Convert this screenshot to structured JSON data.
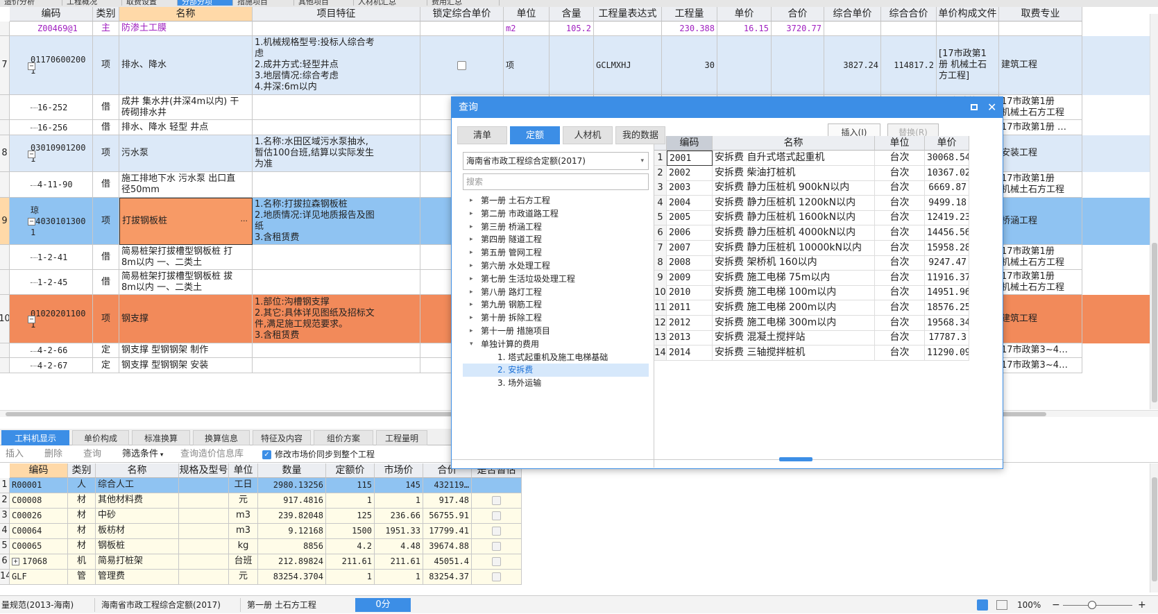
{
  "top_tabs": [
    "造价分析",
    "工程概况",
    "取费设置",
    "分部分项",
    "措施项目",
    "其他项目",
    "人材机汇总",
    "费用汇总"
  ],
  "grid": {
    "headers": [
      "编码",
      "类别",
      "名称",
      "项目特征",
      "锁定综合单价",
      "单位",
      "含量",
      "工程量表达式",
      "工程量",
      "单价",
      "合价",
      "综合单价",
      "综合合价",
      "单价构成文件",
      "取费专业"
    ],
    "rows": [
      {
        "no": "",
        "code": "Z00469@1",
        "type": "主",
        "name": "防渗土工膜",
        "feature": "",
        "unit": "m2",
        "content": "105.2",
        "expr": "",
        "qty": "230.388",
        "price": "16.15",
        "total": "3720.77",
        "uprice": "",
        "utotal": "",
        "file": "",
        "prof": ""
      },
      {
        "no": "7",
        "code": "01170600200\n1",
        "type": "项",
        "name": "排水、降水",
        "feature": "1.机械规格型号:投标人综合考\n虑\n2.成井方式:轻型井点\n3.地层情况:综合考虑\n4.井深:6m以内",
        "unit": "项",
        "content": "",
        "expr": "GCLMXHJ",
        "qty": "30",
        "price": "",
        "total": "",
        "uprice": "3827.24",
        "utotal": "114817.2",
        "file": "[17市政第1\n册  机械土石\n方工程]",
        "prof": "建筑工程"
      },
      {
        "no": "",
        "code": "16-252",
        "type": "借",
        "name": "成井 集水井(井深4m以内) 干\n砖砌排水井",
        "feature": "",
        "unit": "",
        "content": "",
        "expr": "",
        "qty": "",
        "price": "",
        "total": "",
        "uprice": "",
        "utotal": "",
        "file": "17市政第1册\n机械土石方…",
        "prof": "17市政第1册\n机械土石方工程"
      },
      {
        "no": "",
        "code": "16-256",
        "type": "借",
        "name": "排水、降水 轻型 井点",
        "feature": "",
        "unit": "",
        "content": "",
        "expr": "",
        "qty": "",
        "price": "",
        "total": "",
        "uprice": "",
        "utotal": "",
        "file": "17市政第1…",
        "prof": "17市政第1册 …"
      },
      {
        "no": "8",
        "code": "03010901200\n1",
        "type": "项",
        "name": "污水泵",
        "feature": "1.名称:水田区域污水泵抽水,\n暂估100台班,结算以实际发生\n为准",
        "unit": "",
        "content": "",
        "expr": "",
        "qty": "",
        "price": "",
        "total": "",
        "uprice": "",
        "utotal": "",
        "file": "17市政第1\n册  机械土石\n方工程]",
        "prof": "安装工程"
      },
      {
        "no": "",
        "code": "4-11-90",
        "type": "借",
        "name": "施工排地下水 污水泵 出口直\n径50mm",
        "feature": "",
        "unit": "",
        "content": "",
        "expr": "",
        "qty": "",
        "price": "",
        "total": "",
        "uprice": "",
        "utotal": "",
        "file": "17市政第1册\n机械土石方…",
        "prof": "17市政第1册\n机械土石方工程"
      },
      {
        "no": "9",
        "code": "琼\n04030101300\n1",
        "type": "项",
        "name": "打拔钢板桩",
        "feature": "1.名称:打拔拉森钢板桩\n2.地质情况:详见地质报告及图\n纸\n3.含租赁费",
        "unit": "",
        "content": "",
        "expr": "",
        "qty": "",
        "price": "",
        "total": "",
        "uprice": "",
        "utotal": "",
        "file": "17市政第1\n册  机械土石\n方工程]",
        "prof": "桥涵工程"
      },
      {
        "no": "",
        "code": "1-2-41",
        "type": "借",
        "name": "简易桩架打拔槽型钢板桩 打\n8m以内 一、二类土",
        "feature": "",
        "unit": "",
        "content": "",
        "expr": "",
        "qty": "",
        "price": "",
        "total": "",
        "uprice": "",
        "utotal": "",
        "file": "17市政第1册\n机械土石方…",
        "prof": "17市政第1册\n机械土石方工程"
      },
      {
        "no": "",
        "code": "1-2-45",
        "type": "借",
        "name": "简易桩架打拔槽型钢板桩 拔\n8m以内 一、二类土",
        "feature": "",
        "unit": "",
        "content": "",
        "expr": "",
        "qty": "",
        "price": "",
        "total": "",
        "uprice": "",
        "utotal": "",
        "file": "17市政第1册\n机械土石方…",
        "prof": "17市政第1册\n机械土石方工程"
      },
      {
        "no": "10",
        "code": "01020201100\n1",
        "type": "项",
        "name": "钢支撑",
        "feature": "1.部位:沟槽钢支撑\n2.其它:具体详见图纸及招标文\n件,满足施工规范要求。\n3.含租赁费",
        "unit": "",
        "content": "",
        "expr": "",
        "qty": "",
        "price": "",
        "total": "",
        "uprice": "",
        "utotal": "",
        "file": "17市政第1\n册  机械土石\n方工程]",
        "prof": "建筑工程"
      },
      {
        "no": "",
        "code": "4-2-66",
        "type": "定",
        "name": "钢支撑 型钢钢架 制作",
        "feature": "",
        "unit": "",
        "content": "",
        "expr": "",
        "qty": "",
        "price": "",
        "total": "",
        "uprice": "",
        "utotal": "",
        "file": "17市政第3…",
        "prof": "17市政第3~4…"
      },
      {
        "no": "",
        "code": "4-2-67",
        "type": "定",
        "name": "钢支撑 型钢钢架 安装",
        "feature": "",
        "unit": "",
        "content": "",
        "expr": "",
        "qty": "",
        "price": "",
        "total": "",
        "uprice": "",
        "utotal": "",
        "file": "17市政第3…",
        "prof": "17市政第3~4…"
      }
    ]
  },
  "bottom_tabs": [
    "工料机显示",
    "单价构成",
    "标准换算",
    "换算信息",
    "特征及内容",
    "组价方案",
    "工程量明"
  ],
  "bottom_toolbar": {
    "insert": "插入",
    "delete": "删除",
    "query": "查询",
    "filter": "筛选条件",
    "query_price": "查询造价信息库",
    "sync": "修改市场价同步到整个工程"
  },
  "bottom_grid": {
    "headers": [
      "编码",
      "类别",
      "名称",
      "规格及型号",
      "单位",
      "数量",
      "定额价",
      "市场价",
      "合价",
      "是否暂估"
    ],
    "rows": [
      {
        "no": "1",
        "code": "R00001",
        "type": "人",
        "name": "综合人工",
        "spec": "",
        "unit": "工日",
        "qty": "2980.13256",
        "dprice": "115",
        "mprice": "145",
        "total": "432119…"
      },
      {
        "no": "2",
        "code": "C00008",
        "type": "材",
        "name": "其他材料费",
        "spec": "",
        "unit": "元",
        "qty": "917.4816",
        "dprice": "1",
        "mprice": "1",
        "total": "917.48"
      },
      {
        "no": "3",
        "code": "C00026",
        "type": "材",
        "name": "中砂",
        "spec": "",
        "unit": "m3",
        "qty": "239.82048",
        "dprice": "125",
        "mprice": "236.66",
        "total": "56755.91"
      },
      {
        "no": "4",
        "code": "C00064",
        "type": "材",
        "name": "板枋材",
        "spec": "",
        "unit": "m3",
        "qty": "9.12168",
        "dprice": "1500",
        "mprice": "1951.33",
        "total": "17799.41"
      },
      {
        "no": "5",
        "code": "C00065",
        "type": "材",
        "name": "钢板桩",
        "spec": "",
        "unit": "kg",
        "qty": "8856",
        "dprice": "4.2",
        "mprice": "4.48",
        "total": "39674.88"
      },
      {
        "no": "6",
        "code": "17068",
        "type": "机",
        "name": "简易打桩架",
        "spec": "",
        "unit": "台班",
        "qty": "212.89824",
        "dprice": "211.61",
        "mprice": "211.61",
        "total": "45051.4"
      },
      {
        "no": "14",
        "code": "GLF",
        "type": "管",
        "name": "管理费",
        "spec": "",
        "unit": "元",
        "qty": "83254.3704",
        "dprice": "1",
        "mprice": "1",
        "total": "83254.37"
      }
    ]
  },
  "status": {
    "spec": "量规范(2013-海南)",
    "quota": "海南省市政工程综合定额(2017)",
    "chapter": "第一册 土石方工程",
    "score": "0分",
    "zoom": "100%"
  },
  "dialog": {
    "title": "查询",
    "tabs": [
      "清单",
      "定额",
      "人材机",
      "我的数据"
    ],
    "insert": "插入(I)",
    "replace": "替换(R)",
    "select_value": "海南省市政工程综合定额(2017)",
    "search_placeholder": "搜索",
    "tree": [
      {
        "label": "第一册 土石方工程",
        "level": 0,
        "arrow": "▸"
      },
      {
        "label": "第二册 市政道路工程",
        "level": 0,
        "arrow": "▸"
      },
      {
        "label": "第三册 桥涵工程",
        "level": 0,
        "arrow": "▸"
      },
      {
        "label": "第四册 隧道工程",
        "level": 0,
        "arrow": "▸"
      },
      {
        "label": "第五册 管网工程",
        "level": 0,
        "arrow": "▸"
      },
      {
        "label": "第六册 水处理工程",
        "level": 0,
        "arrow": "▸"
      },
      {
        "label": "第七册 生活垃圾处理工程",
        "level": 0,
        "arrow": "▸"
      },
      {
        "label": "第八册 路灯工程",
        "level": 0,
        "arrow": "▸"
      },
      {
        "label": "第九册 钢筋工程",
        "level": 0,
        "arrow": "▸"
      },
      {
        "label": "第十册 拆除工程",
        "level": 0,
        "arrow": "▸"
      },
      {
        "label": "第十一册 措施项目",
        "level": 0,
        "arrow": "▸"
      },
      {
        "label": "单独计算的费用",
        "level": 0,
        "arrow": "▾"
      },
      {
        "label": "1. 塔式起重机及施工电梯基础",
        "level": 1,
        "arrow": ""
      },
      {
        "label": "2. 安拆费",
        "level": 1,
        "arrow": ""
      },
      {
        "label": "3. 场外运输",
        "level": 1,
        "arrow": ""
      }
    ],
    "headers": [
      "编码",
      "名称",
      "单位",
      "单价"
    ],
    "rows": [
      {
        "no": "1",
        "code": "2001",
        "name": "安拆费 自升式塔式起重机",
        "unit": "台次",
        "price": "30068.54"
      },
      {
        "no": "2",
        "code": "2002",
        "name": "安拆费 柴油打桩机",
        "unit": "台次",
        "price": "10367.02"
      },
      {
        "no": "3",
        "code": "2003",
        "name": "安拆费 静力压桩机 900kN以内",
        "unit": "台次",
        "price": "6669.87"
      },
      {
        "no": "4",
        "code": "2004",
        "name": "安拆费 静力压桩机 1200kN以内",
        "unit": "台次",
        "price": "9499.18"
      },
      {
        "no": "5",
        "code": "2005",
        "name": "安拆费 静力压桩机 1600kN以内",
        "unit": "台次",
        "price": "12419.23"
      },
      {
        "no": "6",
        "code": "2006",
        "name": "安拆费 静力压桩机 4000kN以内",
        "unit": "台次",
        "price": "14456.56"
      },
      {
        "no": "7",
        "code": "2007",
        "name": "安拆费 静力压桩机 10000kN以内",
        "unit": "台次",
        "price": "15958.28"
      },
      {
        "no": "8",
        "code": "2008",
        "name": "安拆费 架桥机 160以内",
        "unit": "台次",
        "price": "9247.47"
      },
      {
        "no": "9",
        "code": "2009",
        "name": "安拆费 施工电梯 75m以内",
        "unit": "台次",
        "price": "11916.37"
      },
      {
        "no": "10",
        "code": "2010",
        "name": "安拆费 施工电梯 100m以内",
        "unit": "台次",
        "price": "14951.96"
      },
      {
        "no": "11",
        "code": "2011",
        "name": "安拆费 施工电梯 200m以内",
        "unit": "台次",
        "price": "18576.25"
      },
      {
        "no": "12",
        "code": "2012",
        "name": "安拆费 施工电梯 300m以内",
        "unit": "台次",
        "price": "19568.34"
      },
      {
        "no": "13",
        "code": "2013",
        "name": "安拆费 混凝土搅拌站",
        "unit": "台次",
        "price": "17787.3"
      },
      {
        "no": "14",
        "code": "2014",
        "name": "安拆费 三轴搅拌桩机",
        "unit": "台次",
        "price": "11290.09"
      }
    ]
  },
  "colors": {
    "accent": "#3c8ee6",
    "row_blue": "#dce9f8",
    "row_selected": "#8fc3f2",
    "row_orange": "#f28a5a",
    "name_cell_selected": "#f79a66",
    "row_yellow": "#fffce8",
    "purple": "#a020c0"
  }
}
